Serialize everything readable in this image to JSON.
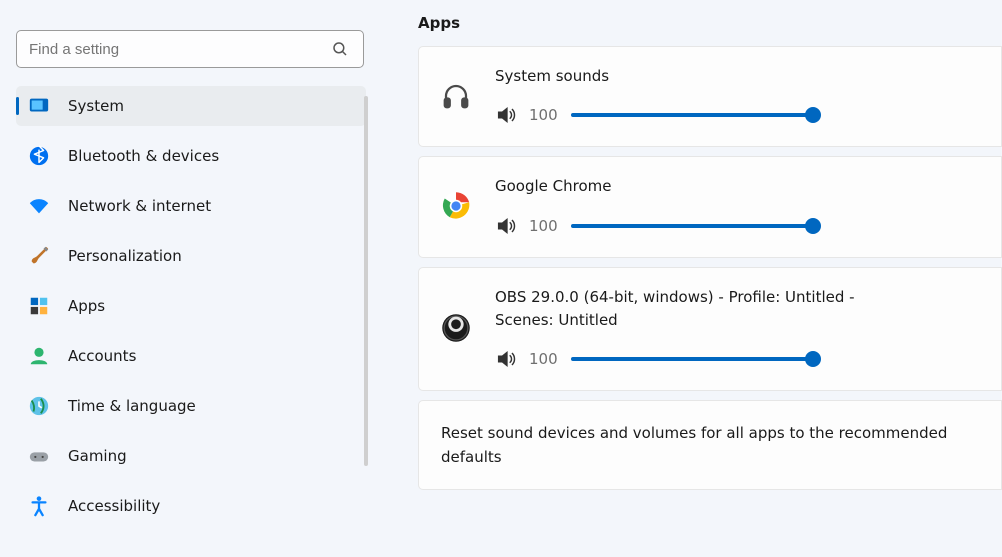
{
  "search": {
    "placeholder": "Find a setting"
  },
  "sidebar": {
    "items": [
      {
        "label": "System",
        "active": true,
        "icon": "system"
      },
      {
        "label": "Bluetooth & devices",
        "active": false,
        "icon": "bluetooth"
      },
      {
        "label": "Network & internet",
        "active": false,
        "icon": "wifi"
      },
      {
        "label": "Personalization",
        "active": false,
        "icon": "brush"
      },
      {
        "label": "Apps",
        "active": false,
        "icon": "apps"
      },
      {
        "label": "Accounts",
        "active": false,
        "icon": "accounts"
      },
      {
        "label": "Time & language",
        "active": false,
        "icon": "time"
      },
      {
        "label": "Gaming",
        "active": false,
        "icon": "gaming"
      },
      {
        "label": "Accessibility",
        "active": false,
        "icon": "accessibility"
      }
    ]
  },
  "main": {
    "section_title": "Apps",
    "apps": [
      {
        "name": "System sounds",
        "volume": 100,
        "icon": "headphones"
      },
      {
        "name": "Google Chrome",
        "volume": 100,
        "icon": "chrome"
      },
      {
        "name": "OBS 29.0.0 (64-bit, windows) - Profile: Untitled - Scenes: Untitled",
        "volume": 100,
        "icon": "obs"
      }
    ],
    "reset_label": "Reset sound devices and volumes for all apps to the recommended defaults"
  }
}
